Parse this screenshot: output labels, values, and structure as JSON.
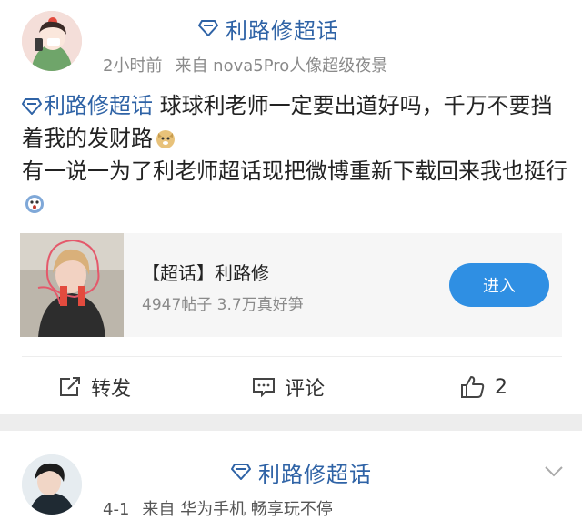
{
  "post1": {
    "topic": "利路修超话",
    "meta": {
      "time": "2小时前",
      "source": "来自 nova5Pro人像超级夜景"
    },
    "content": {
      "tag": "利路修超话",
      "line1_rest": " 球球利老师一定要出道好吗，千万不要挡着我的发财路",
      "line2": "有一说一为了利老师超话现把微博重新下载回来我也挺行"
    },
    "card": {
      "title": "【超话】利路修",
      "stats": "4947帖子 3.7万真好笋",
      "button": "进入"
    },
    "actions": {
      "repost": "转发",
      "comment": "评论",
      "like_count": "2"
    }
  },
  "post2": {
    "topic": "利路修超话",
    "meta": {
      "date": "4-1",
      "source": "来自 华为手机 畅享玩不停"
    }
  },
  "colors": {
    "link_blue": "#2f63a6",
    "button_blue": "#2f8fe3",
    "meta_gray": "#8a8a8a",
    "card_bg": "#f6f6f6",
    "separator": "#ededed"
  },
  "icons": [
    "diamond-icon",
    "repost-icon",
    "comment-icon",
    "like-icon",
    "chevron-down-icon"
  ]
}
